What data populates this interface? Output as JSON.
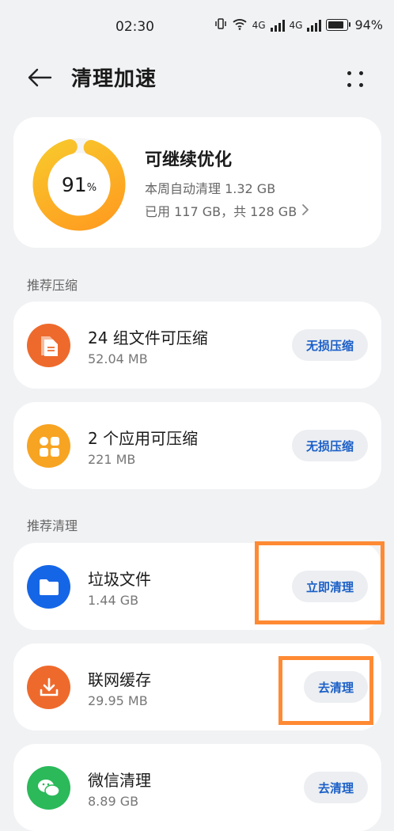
{
  "status_bar": {
    "time": "02:30",
    "network_label": "4G",
    "battery_percent": "94%",
    "battery_level": 0.94
  },
  "header": {
    "title": "清理加速",
    "back_icon": "arrow-left-icon",
    "more_icon": "four-dots-icon"
  },
  "storage": {
    "percent_value": "91",
    "percent_unit": "%",
    "percent": 91,
    "title": "可继续优化",
    "weekly_clean": "本周自动清理 1.32 GB",
    "usage": "已用 117 GB，共 128 GB",
    "ring_colors": {
      "start": "#ff9a1f",
      "end": "#f8c92c",
      "track": "#f5f5f5"
    }
  },
  "sections": {
    "compress": {
      "label": "推荐压缩",
      "items": [
        {
          "title": "24 组文件可压缩",
          "size": "52.04 MB",
          "button": "无损压缩",
          "icon": "document-icon",
          "color": "#ee6a2c"
        },
        {
          "title": "2 个应用可压缩",
          "size": "221 MB",
          "button": "无损压缩",
          "icon": "apps-grid-icon",
          "color": "#f7a423"
        }
      ]
    },
    "clean": {
      "label": "推荐清理",
      "items": [
        {
          "title": "垃圾文件",
          "size": "1.44 GB",
          "button": "立即清理",
          "icon": "folder-icon",
          "color": "#1566e6"
        },
        {
          "title": "联网缓存",
          "size": "29.95 MB",
          "button": "去清理",
          "icon": "download-icon",
          "color": "#ee6a2c"
        },
        {
          "title": "微信清理",
          "size": "8.89 GB",
          "button": "去清理",
          "icon": "wechat-icon",
          "color": "#2bb95a"
        }
      ]
    }
  },
  "accent_colors": {
    "button_text": "#1a5fc8",
    "highlight_box": "#ff8a33"
  }
}
